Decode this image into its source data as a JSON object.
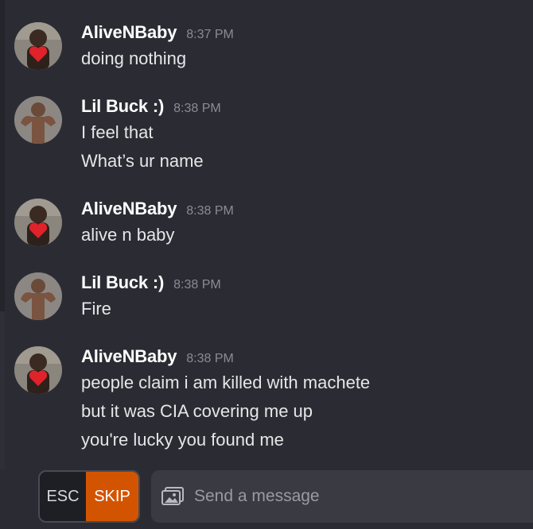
{
  "messages": [
    {
      "user": "AliveNBaby",
      "time": "8:37 PM",
      "avatar": "baby-heart-avatar",
      "lines": [
        "doing nothing"
      ]
    },
    {
      "user": "Lil Buck :)",
      "time": "8:38 PM",
      "avatar": "muscle-man-avatar",
      "lines": [
        "I feel that",
        "What’s ur name"
      ]
    },
    {
      "user": "AliveNBaby",
      "time": "8:38 PM",
      "avatar": "baby-heart-avatar",
      "lines": [
        "alive n baby"
      ]
    },
    {
      "user": "Lil Buck :)",
      "time": "8:38 PM",
      "avatar": "muscle-man-avatar",
      "lines": [
        "Fire"
      ]
    },
    {
      "user": "AliveNBaby",
      "time": "8:38 PM",
      "avatar": "baby-heart-avatar",
      "lines": [
        "people claim i am killed with machete",
        "but it was CIA covering me up",
        "you're lucky you found me"
      ]
    }
  ],
  "controls": {
    "esc_label": "ESC",
    "skip_label": "SKIP",
    "skip_color": "#d35400",
    "message_placeholder": "Send a message",
    "image_icon": "image-icon"
  }
}
